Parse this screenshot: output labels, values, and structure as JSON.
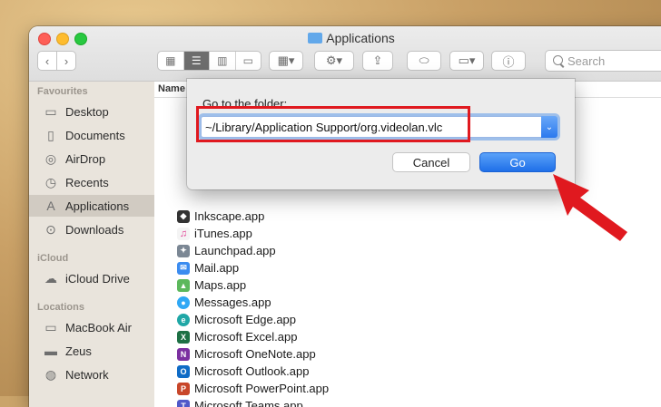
{
  "window": {
    "title": "Applications"
  },
  "toolbar": {
    "search_placeholder": "Search"
  },
  "sidebar": {
    "favourites_heading": "Favourites",
    "favourites": [
      {
        "label": "Desktop",
        "icon": "desktop-icon"
      },
      {
        "label": "Documents",
        "icon": "documents-icon"
      },
      {
        "label": "AirDrop",
        "icon": "airdrop-icon"
      },
      {
        "label": "Recents",
        "icon": "recents-icon"
      },
      {
        "label": "Applications",
        "icon": "applications-icon",
        "selected": true
      },
      {
        "label": "Downloads",
        "icon": "downloads-icon"
      }
    ],
    "icloud_heading": "iCloud",
    "icloud": [
      {
        "label": "iCloud Drive",
        "icon": "cloud-icon"
      }
    ],
    "locations_heading": "Locations",
    "locations": [
      {
        "label": "MacBook Air",
        "icon": "laptop-icon"
      },
      {
        "label": "Zeus",
        "icon": "drive-icon"
      },
      {
        "label": "Network",
        "icon": "globe-icon"
      }
    ]
  },
  "content": {
    "column_name": "Name",
    "files": [
      "Inkscape.app",
      "iTunes.app",
      "Launchpad.app",
      "Mail.app",
      "Maps.app",
      "Messages.app",
      "Microsoft Edge.app",
      "Microsoft Excel.app",
      "Microsoft OneNote.app",
      "Microsoft Outlook.app",
      "Microsoft PowerPoint.app",
      "Microsoft Teams.app"
    ]
  },
  "dialog": {
    "label": "Go to the folder:",
    "path_value": "~/Library/Application Support/org.videolan.vlc",
    "cancel_label": "Cancel",
    "go_label": "Go"
  },
  "colors": {
    "accent": "#2b79ee",
    "highlight": "#e0191f",
    "arrow": "#e0191f"
  }
}
